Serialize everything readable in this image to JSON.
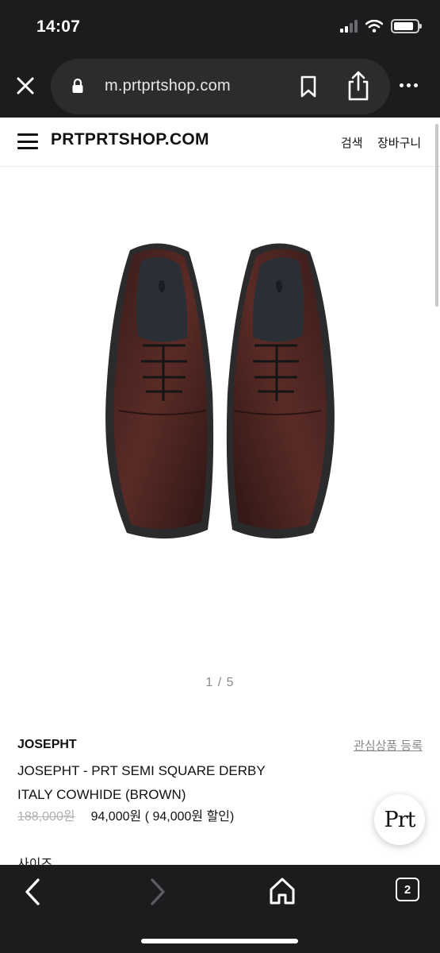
{
  "status_bar": {
    "time": "14:07"
  },
  "browser": {
    "url": "m.prtprtshop.com",
    "tab_count": "2"
  },
  "header": {
    "logo": "PRTPRTSHOP.COM",
    "search_label": "검색",
    "cart_label": "장바구니"
  },
  "gallery": {
    "pager": "1 / 5"
  },
  "product": {
    "brand": "JOSEPHT",
    "wishlist_label": "관심상품 등록",
    "name_line1": "JOSEPHT - PRT SEMI SQUARE DERBY",
    "name_line2": "ITALY COWHIDE (BROWN)",
    "original_price": "188,000원",
    "sale_price": "94,000원",
    "discount": "( 94,000원 할인)",
    "size_label": "사이즈"
  },
  "chat_badge": {
    "label": "Prt"
  },
  "icons": {
    "close": "close-icon",
    "lock": "lock-icon",
    "bookmark": "bookmark-icon",
    "share": "share-icon",
    "more": "more-icon",
    "menu": "hamburger-icon",
    "back": "chevron-left-icon",
    "forward": "chevron-right-icon",
    "home": "home-icon",
    "tabs": "tabs-icon"
  },
  "colors": {
    "chrome": "#1c1c1e",
    "pill": "#2c2c2e",
    "leather": "#4a2320"
  }
}
